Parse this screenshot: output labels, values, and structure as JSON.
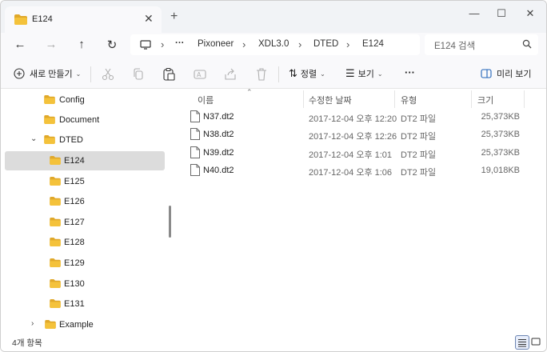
{
  "colors": {
    "folder": "#f4c23b",
    "folder_dark": "#e0a82a",
    "selected": "#dcdcdc",
    "accent": "#1f62b8"
  },
  "window": {
    "tab_title": "E124",
    "tab_close": "✕",
    "new_tab": "+",
    "minimize": "—",
    "maximize": "☐",
    "close": "✕"
  },
  "nav": {
    "back": "←",
    "forward": "→",
    "up": "↑",
    "refresh": "↻",
    "breadcrumb": [
      "Pixoneer",
      "XDL3.0",
      "DTED",
      "E124"
    ],
    "more": "···",
    "sep": "›",
    "search_placeholder": "E124 검색"
  },
  "toolbar": {
    "new_label": "새로 만들기",
    "sort_label": "정렬",
    "view_label": "보기",
    "more_label": "···",
    "preview_label": "미리 보기"
  },
  "sidebar": {
    "items": [
      {
        "label": "Config"
      },
      {
        "label": "Document"
      },
      {
        "label": "DTED"
      },
      {
        "label": "E124"
      },
      {
        "label": "E125"
      },
      {
        "label": "E126"
      },
      {
        "label": "E127"
      },
      {
        "label": "E128"
      },
      {
        "label": "E129"
      },
      {
        "label": "E130"
      },
      {
        "label": "E131"
      },
      {
        "label": "Example"
      }
    ]
  },
  "table": {
    "headers": {
      "name": "이름",
      "date": "수정한 날짜",
      "type": "유형",
      "size": "크기"
    },
    "sort_arrow": "⌃",
    "rows": [
      {
        "name": "N37.dt2",
        "date": "2017-12-04 오후 12:20",
        "type": "DT2 파일",
        "size": "25,373KB"
      },
      {
        "name": "N38.dt2",
        "date": "2017-12-04 오후 12:26",
        "type": "DT2 파일",
        "size": "25,373KB"
      },
      {
        "name": "N39.dt2",
        "date": "2017-12-04 오후 1:01",
        "type": "DT2 파일",
        "size": "25,373KB"
      },
      {
        "name": "N40.dt2",
        "date": "2017-12-04 오후 1:06",
        "type": "DT2 파일",
        "size": "19,018KB"
      }
    ]
  },
  "status": {
    "item_count": "4개 항목"
  }
}
